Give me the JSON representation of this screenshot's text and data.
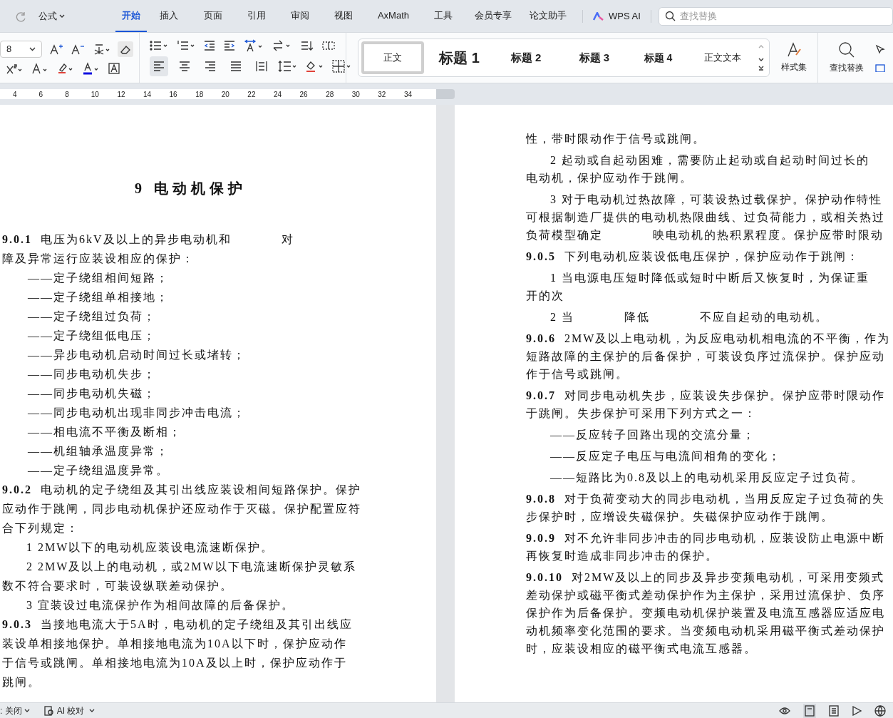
{
  "quick_access": {
    "label": "公式"
  },
  "tabs": [
    {
      "label": "开始",
      "selected": true
    },
    {
      "label": "插入",
      "selected": false
    },
    {
      "label": "页面",
      "selected": false
    },
    {
      "label": "引用",
      "selected": false
    },
    {
      "label": "审阅",
      "selected": false
    },
    {
      "label": "视图",
      "selected": false
    },
    {
      "label": "AxMath",
      "selected": false
    },
    {
      "label": "工具",
      "selected": false
    },
    {
      "label": "会员专享",
      "selected": false
    },
    {
      "label": "论文助手",
      "selected": false
    }
  ],
  "ai_button": {
    "label": "WPS AI"
  },
  "search": {
    "placeholder": "查找替换"
  },
  "ribbon": {
    "font_size": "8",
    "align_left_selected": true,
    "styles": [
      {
        "label": "正文",
        "kind": "body",
        "selected": true
      },
      {
        "label": "标题 1",
        "kind": "h1",
        "selected": false
      },
      {
        "label": "标题 2",
        "kind": "h2",
        "selected": false
      },
      {
        "label": "标题 3",
        "kind": "h3",
        "selected": false
      },
      {
        "label": "标题 4",
        "kind": "h4",
        "selected": false
      },
      {
        "label": "正文文本",
        "kind": "body",
        "selected": false
      }
    ],
    "style_set": "样式集",
    "find_replace": "查找替换"
  },
  "ruler": [
    "4",
    "6",
    "8",
    "10",
    "12",
    "14",
    "16",
    "18",
    "20",
    "22",
    "24",
    "26",
    "28",
    "30",
    "32",
    "34"
  ],
  "pages": [
    {
      "paragraphs": [
        {
          "kind": "heading",
          "lines": [
            "9 电动机保护"
          ]
        },
        {
          "kind": "clause",
          "lines": [
            [
              "**9.0.1**  电压为6kV及以上的异步电动机和",
              "对"
            ],
            "障及异常运行应装设相应的保护："
          ]
        },
        {
          "kind": "dash",
          "lines": [
            "——定子绕组相间短路；"
          ]
        },
        {
          "kind": "dash",
          "lines": [
            "——定子绕组单相接地；"
          ]
        },
        {
          "kind": "dash",
          "lines": [
            "——定子绕组过负荷；"
          ]
        },
        {
          "kind": "dash",
          "lines": [
            "——定子绕组低电压；"
          ]
        },
        {
          "kind": "dash",
          "lines": [
            "——异步电动机启动时间过长或堵转；"
          ]
        },
        {
          "kind": "dash",
          "lines": [
            "——同步电动机失步；"
          ]
        },
        {
          "kind": "dash",
          "lines": [
            "——同步电动机失磁；"
          ]
        },
        {
          "kind": "dash",
          "lines": [
            "——同步电动机出现非同步冲击电流；"
          ]
        },
        {
          "kind": "dash",
          "lines": [
            "——相电流不平衡及断相；"
          ]
        },
        {
          "kind": "dash",
          "lines": [
            "——机组轴承温度异常；"
          ]
        },
        {
          "kind": "dash",
          "lines": [
            "——定子绕组温度异常。"
          ]
        },
        {
          "kind": "clause",
          "lines": [
            "**9.0.2**  电动机的定子绕组及其引出线应装设相间短路保护。保护",
            "应动作于跳闸，同步电动机保护还应动作于灭磁。保护配置应符",
            "合下列规定："
          ]
        },
        {
          "kind": "item",
          "lines": [
            "1 2MW以下的电动机应装设电流速断保护。"
          ]
        },
        {
          "kind": "item",
          "lines": [
            "2 2MW及以上的电动机，或2MW以下电流速断保护灵敏系",
            "数不符合要求时，可装设纵联差动保护。"
          ]
        },
        {
          "kind": "item",
          "lines": [
            "3 宜装设过电流保护作为相间故障的后备保护。"
          ]
        },
        {
          "kind": "clause",
          "lines": [
            "**9.0.3**  当接地电流大于5A时，电动机的定子绕组及其引出线应",
            "装设单相接地保护。单相接地电流为10A以下时，保护应动作",
            "于信号或跳闸。单相接地电流为10A及以上时，保护应动作于",
            "跳闸。"
          ]
        }
      ]
    },
    {
      "paragraphs": [
        {
          "kind": "cont",
          "lines": [
            "性，带时限动作于信号或跳闸。"
          ]
        },
        {
          "kind": "item",
          "lines": [
            "2 起动或自起动困难，需要防止起动或自起动时间过长的",
            "电动机，保护应动作于跳闸。"
          ]
        },
        {
          "kind": "item",
          "lines": [
            "3 对于电动机过热故障，可装设热过载保护。保护动作特性",
            "可根据制造厂提供的电动机热限曲线、过负荷能力，或相关热过",
            [
              "负荷模型确定",
              "映电动机的热积累程度。保护应带时限动"
            ]
          ]
        },
        {
          "kind": "clause",
          "lines": [
            "**9.0.5**  下列电动机应装设低电压保护，保护应动作于跳闸："
          ]
        },
        {
          "kind": "item",
          "lines": [
            "1 当电源电压短时降低或短时中断后又恢复时，为保证重",
            "开的次"
          ]
        },
        {
          "kind": "item",
          "lines": [
            [
              "2 当",
              "降低",
              "不应自起动的电动机。"
            ]
          ]
        },
        {
          "kind": "clause",
          "lines": [
            "**9.0.6**  2MW及以上电动机，为反应电动机相电流的不平衡，作为",
            "短路故障的主保护的后备保护，可装设负序过流保护。保护应动",
            "作于信号或跳闸。"
          ]
        },
        {
          "kind": "clause",
          "lines": [
            "**9.0.7**  对同步电动机失步，应装设失步保护。保护应带时限动作",
            "于跳闸。失步保护可采用下列方式之一："
          ]
        },
        {
          "kind": "dash",
          "lines": [
            "——反应转子回路出现的交流分量；"
          ]
        },
        {
          "kind": "dash",
          "lines": [
            "——反应定子电压与电流间相角的变化；"
          ]
        },
        {
          "kind": "dash",
          "lines": [
            "——短路比为0.8及以上的电动机采用反应定子过负荷。"
          ]
        },
        {
          "kind": "clause",
          "lines": [
            "**9.0.8**  对于负荷变动大的同步电动机，当用反应定子过负荷的失",
            "步保护时，应增设失磁保护。失磁保护应动作于跳闸。"
          ]
        },
        {
          "kind": "clause",
          "lines": [
            "**9.0.9**  对不允许非同步冲击的同步电动机，应装设防止电源中断",
            "再恢复时造成非同步冲击的保护。"
          ]
        },
        {
          "kind": "clause",
          "lines": [
            "**9.0.10**  对2MW及以上的同步及异步变频电动机，可采用变频式",
            "差动保护或磁平衡式差动保护作为主保护，采用过流保护、负序",
            "保护作为后备保护。变频电动机保护装置及电流互感器应适应电",
            "动机频率变化范围的要求。当变频电动机采用磁平衡式差动保护",
            "时，应装设相应的磁平衡式电流互感器。"
          ]
        }
      ]
    }
  ],
  "status_bar": {
    "left": [
      ": 关闭",
      "AI 校对"
    ]
  }
}
